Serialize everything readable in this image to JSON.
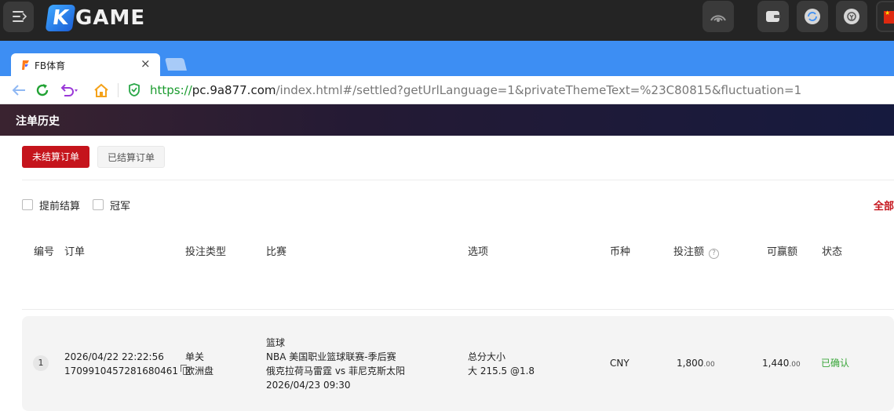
{
  "app": {
    "brand_k": "K",
    "brand_rest": "GAME"
  },
  "browser": {
    "tab_title": "FB体育",
    "tab_close": "×",
    "url_scheme": "https://",
    "url_host": "pc.9a877.com",
    "url_path": "/index.html#/settled?getUrlLanguage=1&privateThemeText=%23C80815&fluctuation=1"
  },
  "page": {
    "title": "注单历史",
    "tab_unsettled": "未结算订单",
    "tab_settled": "已结算订单",
    "filter_early_settle": "提前结算",
    "filter_champion": "冠军",
    "all_link": "全部"
  },
  "table": {
    "headers": {
      "no": "编号",
      "order": "订单",
      "bet_type": "投注类型",
      "match": "比赛",
      "option": "选项",
      "currency": "币种",
      "stake": "投注额",
      "win": "可赢额",
      "status": "状态"
    },
    "help_mark": "?",
    "rows": [
      {
        "no": "1",
        "order_time": "2026/04/22 22:22:56",
        "order_id": "1709910457281680461",
        "bet_type": "单关",
        "odds_type": "欧洲盘",
        "sport": "篮球",
        "league": "NBA 美国职业篮球联赛-季后赛",
        "teams": "俄克拉荷马雷霆 vs 菲尼克斯太阳",
        "match_time": "2026/04/23 09:30",
        "option_market": "总分大小",
        "option_pick": "大 215.5 @1.8",
        "currency": "CNY",
        "stake_int": "1,800",
        "stake_dec": ".00",
        "win_int": "1,440",
        "win_dec": ".00",
        "status": "已确认"
      }
    ]
  },
  "colors": {
    "accent": "#C5141C",
    "browser_blue": "#3D8EF3",
    "status_ok": "#3AA63A"
  }
}
